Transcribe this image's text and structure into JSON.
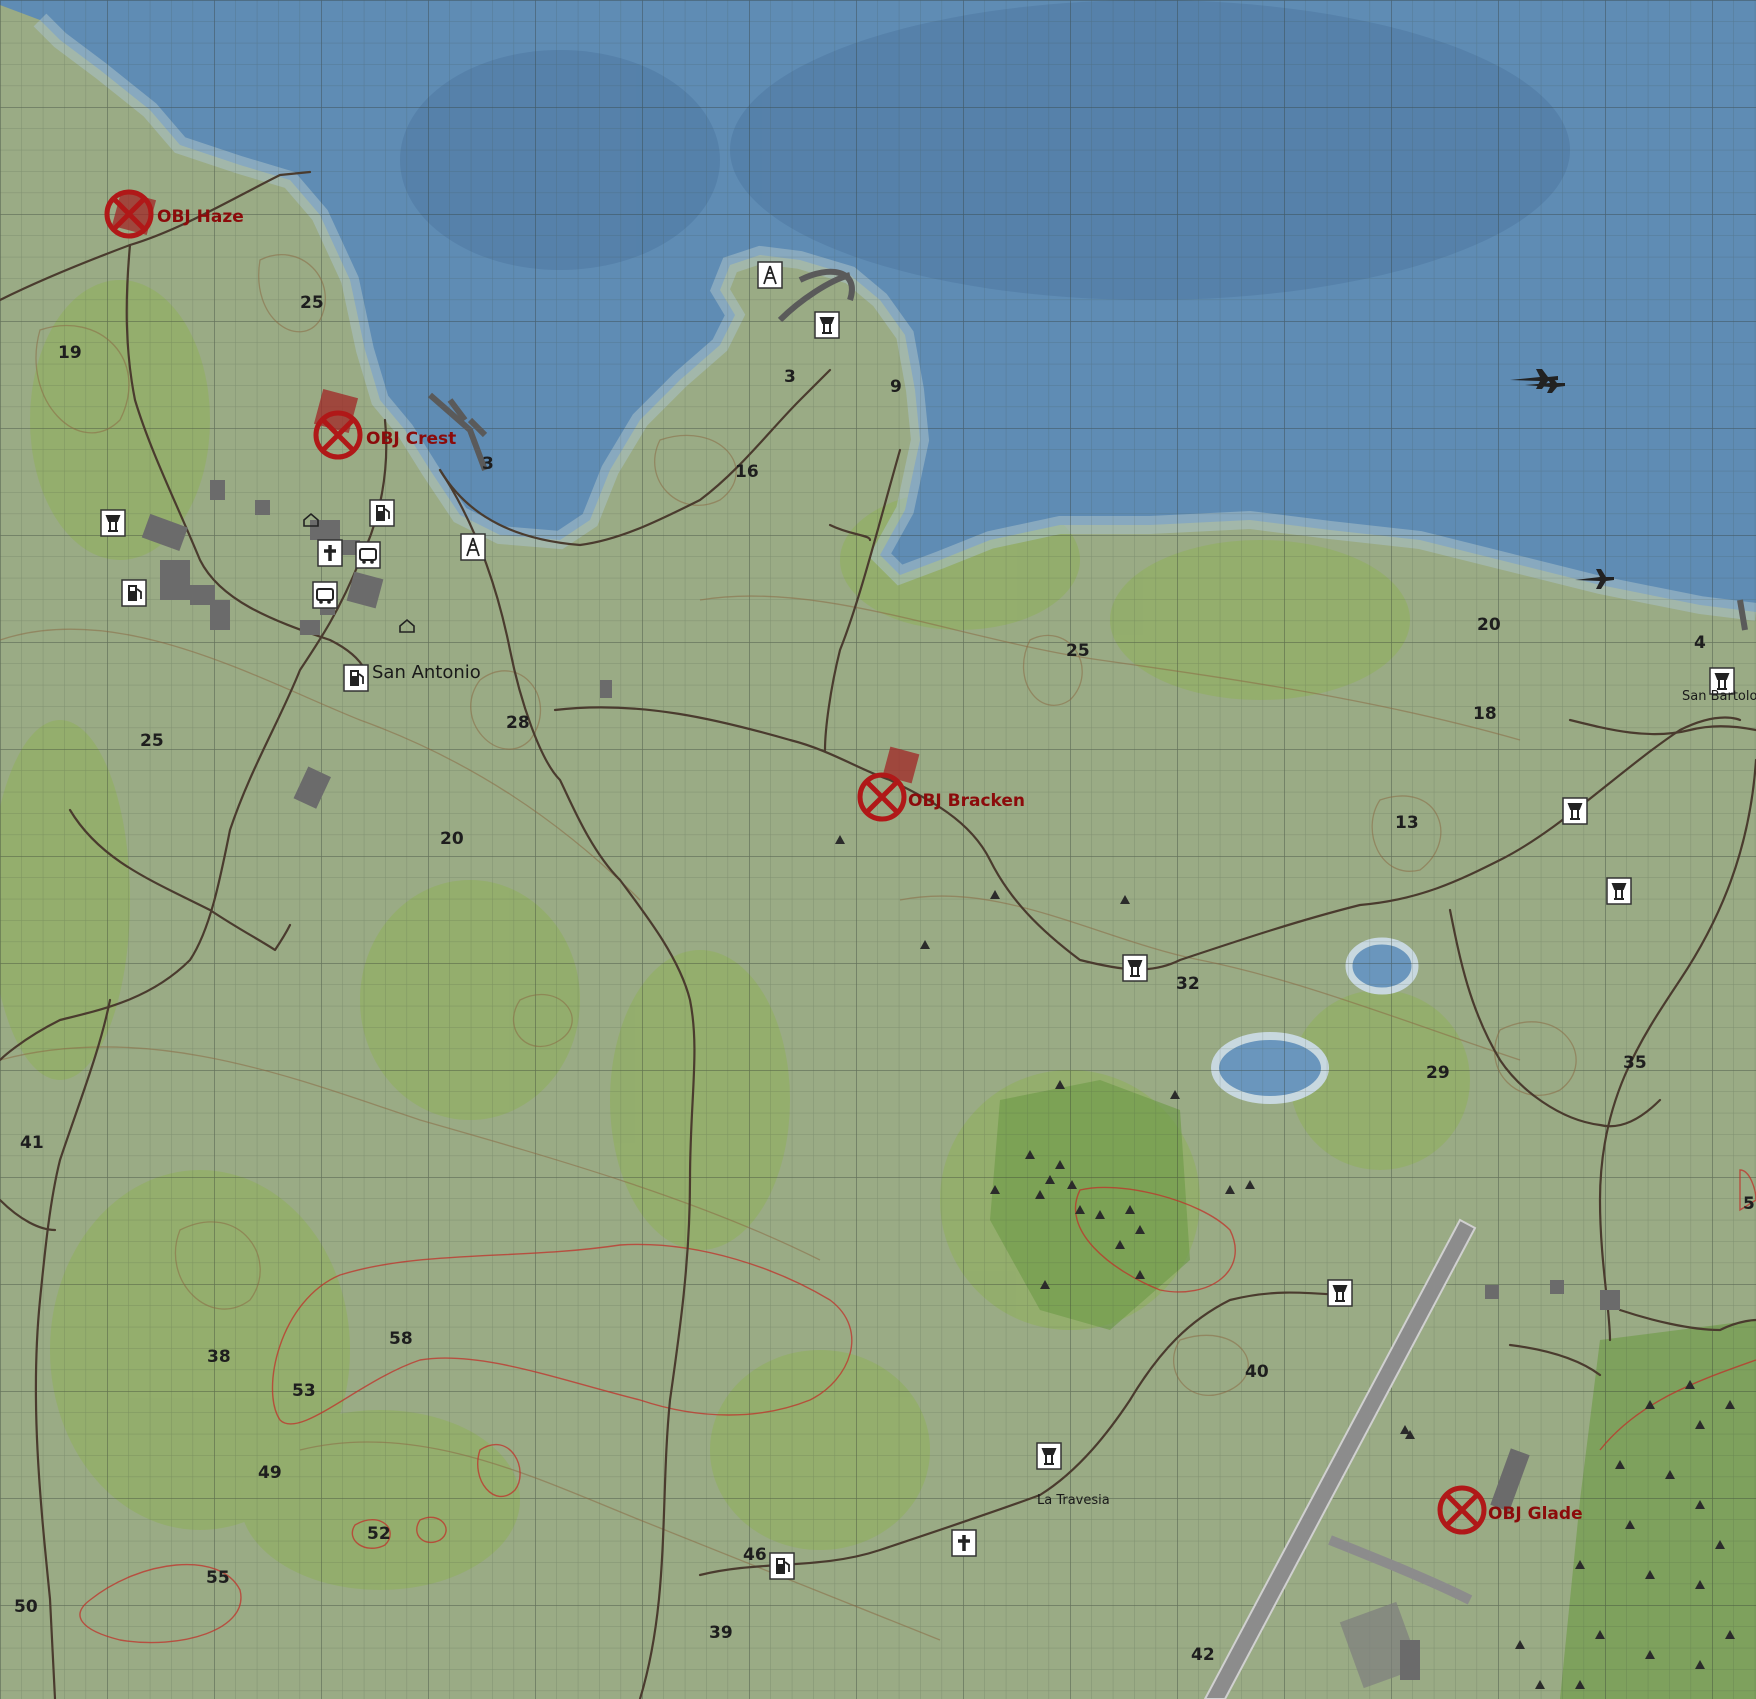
{
  "map": {
    "grid": true,
    "colors": {
      "water": "#5f8cb4",
      "land": "#9aab85",
      "road": "#4a3b2e",
      "contour": "#8a6a44",
      "contour_high": "#c0302a",
      "objective": "#b01818",
      "objective_text": "#8b0b0b"
    }
  },
  "objectives": [
    {
      "id": "haze",
      "label": "OBJ Haze"
    },
    {
      "id": "crest",
      "label": "OBJ Crest"
    },
    {
      "id": "bracken",
      "label": "OBJ Bracken"
    },
    {
      "id": "glade",
      "label": "OBJ Glade"
    }
  ],
  "towns": {
    "san_antonio": "San Antonio",
    "san_bartolo": "San Bartolo",
    "la_travesia": "La Travesia"
  },
  "elevations": [
    "25",
    "19",
    "3",
    "9",
    "16",
    "3",
    "25",
    "28",
    "20",
    "20",
    "18",
    "4",
    "13",
    "32",
    "29",
    "35",
    "41",
    "38",
    "58",
    "53",
    "49",
    "52",
    "55",
    "50",
    "46",
    "39",
    "40",
    "42",
    "5"
  ],
  "icons": {
    "fuel": "fuel-station-icon",
    "hospital": "hospital-cross-icon",
    "bus": "bus-icon",
    "tower": "transmitter-tower-icon",
    "watchtower": "watchtower-icon",
    "plane": "aircraft-icon"
  }
}
